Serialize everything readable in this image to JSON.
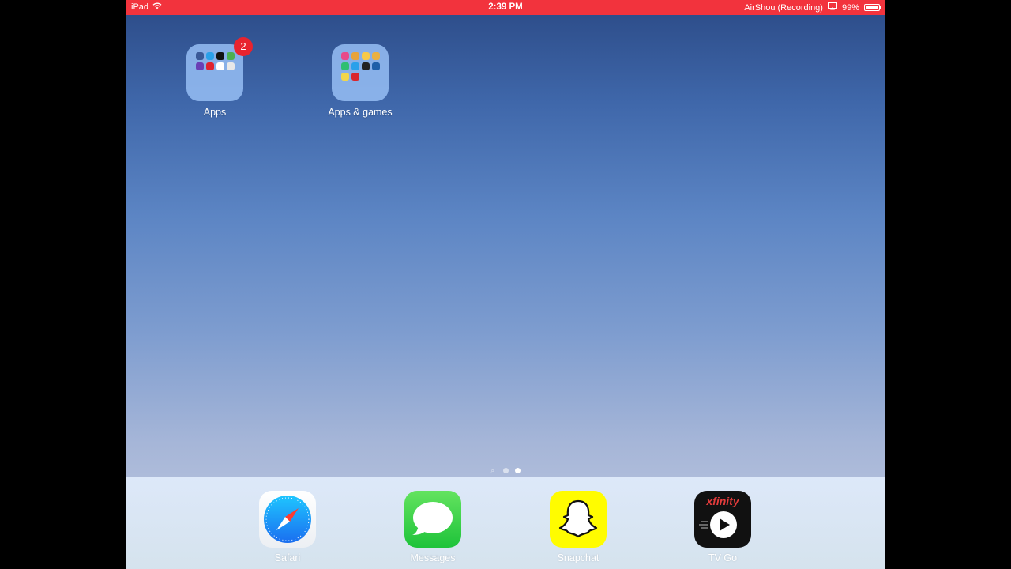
{
  "status_bar": {
    "device": "iPad",
    "time": "2:39 PM",
    "recording": "AirShou (Recording)",
    "battery_text": "99%",
    "battery_level": 0.99,
    "background_color": "#f2333d"
  },
  "home": {
    "folders": [
      {
        "label": "Apps",
        "badge": "2",
        "mini_icons": [
          "#3b5998",
          "#2aa0ea",
          "#111111",
          "#4caf50",
          "#6a3fb5",
          "#e0232e",
          "#ffffff",
          "#e8e8e8"
        ]
      },
      {
        "label": "Apps & games",
        "badge": "",
        "mini_icons": [
          "#e84a8a",
          "#e8a33a",
          "#f7c948",
          "#e9b041",
          "#2fbf71",
          "#2aa0ea",
          "#222222",
          "#1f5fa8",
          "#f2d64b",
          "#d9262c"
        ]
      }
    ],
    "page_dots": {
      "count": 2,
      "active_index": 1,
      "search_dot": true
    }
  },
  "dock": {
    "apps": [
      {
        "label": "Safari",
        "icon": "safari-compass-icon"
      },
      {
        "label": "Messages",
        "icon": "speech-bubble-icon"
      },
      {
        "label": "Snapchat",
        "icon": "ghost-icon"
      },
      {
        "label": "TV Go",
        "icon": "xfinity-play-icon",
        "logo_text": "xfinity"
      }
    ]
  }
}
